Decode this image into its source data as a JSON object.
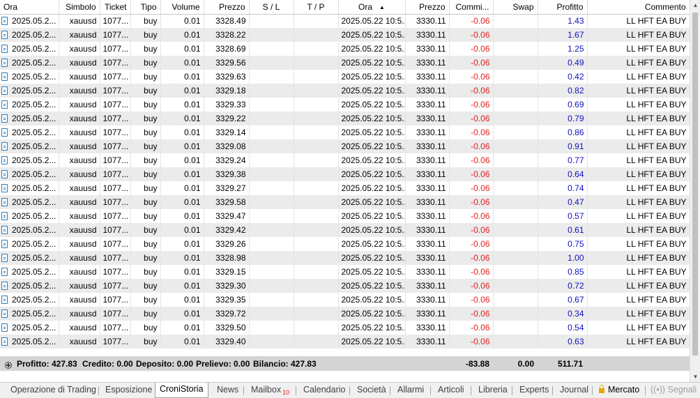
{
  "columns": [
    "Ora",
    "Simbolo",
    "Ticket",
    "Tipo",
    "Volume",
    "Prezzo",
    "S / L",
    "T / P",
    "Ora",
    "Prezzo",
    "Commi...",
    "Swap",
    "Profitto",
    "Commento"
  ],
  "rows": [
    {
      "open_time": "2025.05.2...",
      "symbol": "xauusd",
      "ticket": "1077...",
      "type": "buy",
      "volume": "0.01",
      "open_price": "3328.49",
      "sl": "",
      "tp": "",
      "close_time": "2025.05.22 10:5...",
      "close_price": "3330.11",
      "commission": "-0.06",
      "swap": "",
      "profit": "1.43",
      "comment": "LL HFT EA BUY"
    },
    {
      "open_time": "2025.05.2...",
      "symbol": "xauusd",
      "ticket": "1077...",
      "type": "buy",
      "volume": "0.01",
      "open_price": "3328.22",
      "sl": "",
      "tp": "",
      "close_time": "2025.05.22 10:5...",
      "close_price": "3330.11",
      "commission": "-0.06",
      "swap": "",
      "profit": "1.67",
      "comment": "LL HFT EA BUY"
    },
    {
      "open_time": "2025.05.2...",
      "symbol": "xauusd",
      "ticket": "1077...",
      "type": "buy",
      "volume": "0.01",
      "open_price": "3328.69",
      "sl": "",
      "tp": "",
      "close_time": "2025.05.22 10:5...",
      "close_price": "3330.11",
      "commission": "-0.06",
      "swap": "",
      "profit": "1.25",
      "comment": "LL HFT EA BUY"
    },
    {
      "open_time": "2025.05.2...",
      "symbol": "xauusd",
      "ticket": "1077...",
      "type": "buy",
      "volume": "0.01",
      "open_price": "3329.56",
      "sl": "",
      "tp": "",
      "close_time": "2025.05.22 10:5...",
      "close_price": "3330.11",
      "commission": "-0.06",
      "swap": "",
      "profit": "0.49",
      "comment": "LL HFT EA BUY"
    },
    {
      "open_time": "2025.05.2...",
      "symbol": "xauusd",
      "ticket": "1077...",
      "type": "buy",
      "volume": "0.01",
      "open_price": "3329.63",
      "sl": "",
      "tp": "",
      "close_time": "2025.05.22 10:5...",
      "close_price": "3330.11",
      "commission": "-0.06",
      "swap": "",
      "profit": "0.42",
      "comment": "LL HFT EA BUY"
    },
    {
      "open_time": "2025.05.2...",
      "symbol": "xauusd",
      "ticket": "1077...",
      "type": "buy",
      "volume": "0.01",
      "open_price": "3329.18",
      "sl": "",
      "tp": "",
      "close_time": "2025.05.22 10:5...",
      "close_price": "3330.11",
      "commission": "-0.06",
      "swap": "",
      "profit": "0.82",
      "comment": "LL HFT EA BUY"
    },
    {
      "open_time": "2025.05.2...",
      "symbol": "xauusd",
      "ticket": "1077...",
      "type": "buy",
      "volume": "0.01",
      "open_price": "3329.33",
      "sl": "",
      "tp": "",
      "close_time": "2025.05.22 10:5...",
      "close_price": "3330.11",
      "commission": "-0.06",
      "swap": "",
      "profit": "0.69",
      "comment": "LL HFT EA BUY"
    },
    {
      "open_time": "2025.05.2...",
      "symbol": "xauusd",
      "ticket": "1077...",
      "type": "buy",
      "volume": "0.01",
      "open_price": "3329.22",
      "sl": "",
      "tp": "",
      "close_time": "2025.05.22 10:5...",
      "close_price": "3330.11",
      "commission": "-0.06",
      "swap": "",
      "profit": "0.79",
      "comment": "LL HFT EA BUY"
    },
    {
      "open_time": "2025.05.2...",
      "symbol": "xauusd",
      "ticket": "1077...",
      "type": "buy",
      "volume": "0.01",
      "open_price": "3329.14",
      "sl": "",
      "tp": "",
      "close_time": "2025.05.22 10:5...",
      "close_price": "3330.11",
      "commission": "-0.06",
      "swap": "",
      "profit": "0.86",
      "comment": "LL HFT EA BUY"
    },
    {
      "open_time": "2025.05.2...",
      "symbol": "xauusd",
      "ticket": "1077...",
      "type": "buy",
      "volume": "0.01",
      "open_price": "3329.08",
      "sl": "",
      "tp": "",
      "close_time": "2025.05.22 10:5...",
      "close_price": "3330.11",
      "commission": "-0.06",
      "swap": "",
      "profit": "0.91",
      "comment": "LL HFT EA BUY"
    },
    {
      "open_time": "2025.05.2...",
      "symbol": "xauusd",
      "ticket": "1077...",
      "type": "buy",
      "volume": "0.01",
      "open_price": "3329.24",
      "sl": "",
      "tp": "",
      "close_time": "2025.05.22 10:5...",
      "close_price": "3330.11",
      "commission": "-0.06",
      "swap": "",
      "profit": "0.77",
      "comment": "LL HFT EA BUY"
    },
    {
      "open_time": "2025.05.2...",
      "symbol": "xauusd",
      "ticket": "1077...",
      "type": "buy",
      "volume": "0.01",
      "open_price": "3329.38",
      "sl": "",
      "tp": "",
      "close_time": "2025.05.22 10:5...",
      "close_price": "3330.11",
      "commission": "-0.06",
      "swap": "",
      "profit": "0.64",
      "comment": "LL HFT EA BUY"
    },
    {
      "open_time": "2025.05.2...",
      "symbol": "xauusd",
      "ticket": "1077...",
      "type": "buy",
      "volume": "0.01",
      "open_price": "3329.27",
      "sl": "",
      "tp": "",
      "close_time": "2025.05.22 10:5...",
      "close_price": "3330.11",
      "commission": "-0.06",
      "swap": "",
      "profit": "0.74",
      "comment": "LL HFT EA BUY"
    },
    {
      "open_time": "2025.05.2...",
      "symbol": "xauusd",
      "ticket": "1077...",
      "type": "buy",
      "volume": "0.01",
      "open_price": "3329.58",
      "sl": "",
      "tp": "",
      "close_time": "2025.05.22 10:5...",
      "close_price": "3330.11",
      "commission": "-0.06",
      "swap": "",
      "profit": "0.47",
      "comment": "LL HFT EA BUY"
    },
    {
      "open_time": "2025.05.2...",
      "symbol": "xauusd",
      "ticket": "1077...",
      "type": "buy",
      "volume": "0.01",
      "open_price": "3329.47",
      "sl": "",
      "tp": "",
      "close_time": "2025.05.22 10:5...",
      "close_price": "3330.11",
      "commission": "-0.06",
      "swap": "",
      "profit": "0.57",
      "comment": "LL HFT EA BUY"
    },
    {
      "open_time": "2025.05.2...",
      "symbol": "xauusd",
      "ticket": "1077...",
      "type": "buy",
      "volume": "0.01",
      "open_price": "3329.42",
      "sl": "",
      "tp": "",
      "close_time": "2025.05.22 10:5...",
      "close_price": "3330.11",
      "commission": "-0.06",
      "swap": "",
      "profit": "0.61",
      "comment": "LL HFT EA BUY"
    },
    {
      "open_time": "2025.05.2...",
      "symbol": "xauusd",
      "ticket": "1077...",
      "type": "buy",
      "volume": "0.01",
      "open_price": "3329.26",
      "sl": "",
      "tp": "",
      "close_time": "2025.05.22 10:5...",
      "close_price": "3330.11",
      "commission": "-0.06",
      "swap": "",
      "profit": "0.75",
      "comment": "LL HFT EA BUY"
    },
    {
      "open_time": "2025.05.2...",
      "symbol": "xauusd",
      "ticket": "1077...",
      "type": "buy",
      "volume": "0.01",
      "open_price": "3328.98",
      "sl": "",
      "tp": "",
      "close_time": "2025.05.22 10:5...",
      "close_price": "3330.11",
      "commission": "-0.06",
      "swap": "",
      "profit": "1.00",
      "comment": "LL HFT EA BUY"
    },
    {
      "open_time": "2025.05.2...",
      "symbol": "xauusd",
      "ticket": "1077...",
      "type": "buy",
      "volume": "0.01",
      "open_price": "3329.15",
      "sl": "",
      "tp": "",
      "close_time": "2025.05.22 10:5...",
      "close_price": "3330.11",
      "commission": "-0.06",
      "swap": "",
      "profit": "0.85",
      "comment": "LL HFT EA BUY"
    },
    {
      "open_time": "2025.05.2...",
      "symbol": "xauusd",
      "ticket": "1077...",
      "type": "buy",
      "volume": "0.01",
      "open_price": "3329.30",
      "sl": "",
      "tp": "",
      "close_time": "2025.05.22 10:5...",
      "close_price": "3330.11",
      "commission": "-0.06",
      "swap": "",
      "profit": "0.72",
      "comment": "LL HFT EA BUY"
    },
    {
      "open_time": "2025.05.2...",
      "symbol": "xauusd",
      "ticket": "1077...",
      "type": "buy",
      "volume": "0.01",
      "open_price": "3329.35",
      "sl": "",
      "tp": "",
      "close_time": "2025.05.22 10:5...",
      "close_price": "3330.11",
      "commission": "-0.06",
      "swap": "",
      "profit": "0.67",
      "comment": "LL HFT EA BUY"
    },
    {
      "open_time": "2025.05.2...",
      "symbol": "xauusd",
      "ticket": "1077...",
      "type": "buy",
      "volume": "0.01",
      "open_price": "3329.72",
      "sl": "",
      "tp": "",
      "close_time": "2025.05.22 10:5...",
      "close_price": "3330.11",
      "commission": "-0.06",
      "swap": "",
      "profit": "0.34",
      "comment": "LL HFT EA BUY"
    },
    {
      "open_time": "2025.05.2...",
      "symbol": "xauusd",
      "ticket": "1077...",
      "type": "buy",
      "volume": "0.01",
      "open_price": "3329.50",
      "sl": "",
      "tp": "",
      "close_time": "2025.05.22 10:5...",
      "close_price": "3330.11",
      "commission": "-0.06",
      "swap": "",
      "profit": "0.54",
      "comment": "LL HFT EA BUY"
    },
    {
      "open_time": "2025.05.2...",
      "symbol": "xauusd",
      "ticket": "1077...",
      "type": "buy",
      "volume": "0.01",
      "open_price": "3329.40",
      "sl": "",
      "tp": "",
      "close_time": "2025.05.22 10:5...",
      "close_price": "3330.11",
      "commission": "-0.06",
      "swap": "",
      "profit": "0.63",
      "comment": "LL HFT EA BUY"
    }
  ],
  "summary": {
    "profit_label": "Profitto: 427.83",
    "credit_label": "Credito: 0.00",
    "deposit_label": "Deposito: 0.00",
    "withdrawal_label": "Prelievo: 0.00",
    "balance_label": "Bilancio: 427.83",
    "commission_total": "-83.88",
    "swap_total": "0.00",
    "profit_total": "511.71"
  },
  "tabs": {
    "trading": "Operazione di Trading",
    "exposure": "Esposizione",
    "history": "CroniStoria",
    "news": "News",
    "mailbox": "Mailbox",
    "mailbox_count": "10",
    "calendar": "Calendario",
    "company": "Società",
    "alerts": "Allarmi",
    "articles": "Articoli",
    "library": "Libreria",
    "experts": "Experts",
    "journal": "Journal",
    "market": "Mercato",
    "signals": "Segnali"
  },
  "colors": {
    "negative": "#e02020",
    "positive": "#1010c0",
    "alt_row": "#ebebeb",
    "summary_bg": "#d4d4d4"
  },
  "icons": {
    "row": "document-icon",
    "summary": "plus-circle-icon",
    "market": "lock-icon",
    "signals": "signal-icon",
    "sort": "sort-ascending-icon"
  }
}
